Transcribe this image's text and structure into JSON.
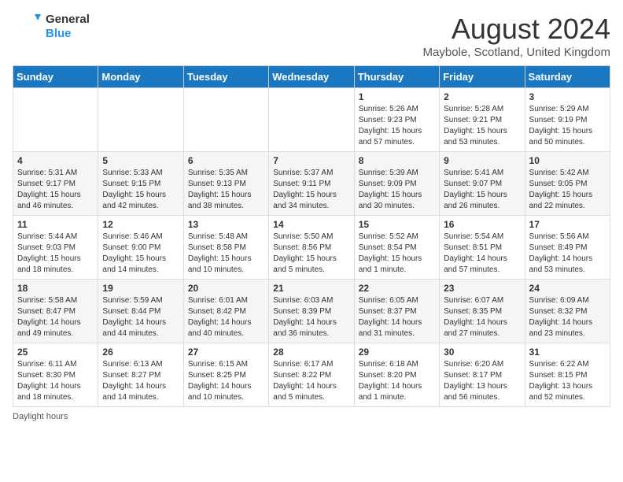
{
  "header": {
    "logo_general": "General",
    "logo_blue": "Blue",
    "month_title": "August 2024",
    "location": "Maybole, Scotland, United Kingdom"
  },
  "days_of_week": [
    "Sunday",
    "Monday",
    "Tuesday",
    "Wednesday",
    "Thursday",
    "Friday",
    "Saturday"
  ],
  "weeks": [
    [
      {
        "day": "",
        "info": ""
      },
      {
        "day": "",
        "info": ""
      },
      {
        "day": "",
        "info": ""
      },
      {
        "day": "",
        "info": ""
      },
      {
        "day": "1",
        "info": "Sunrise: 5:26 AM\nSunset: 9:23 PM\nDaylight: 15 hours\nand 57 minutes."
      },
      {
        "day": "2",
        "info": "Sunrise: 5:28 AM\nSunset: 9:21 PM\nDaylight: 15 hours\nand 53 minutes."
      },
      {
        "day": "3",
        "info": "Sunrise: 5:29 AM\nSunset: 9:19 PM\nDaylight: 15 hours\nand 50 minutes."
      }
    ],
    [
      {
        "day": "4",
        "info": "Sunrise: 5:31 AM\nSunset: 9:17 PM\nDaylight: 15 hours\nand 46 minutes."
      },
      {
        "day": "5",
        "info": "Sunrise: 5:33 AM\nSunset: 9:15 PM\nDaylight: 15 hours\nand 42 minutes."
      },
      {
        "day": "6",
        "info": "Sunrise: 5:35 AM\nSunset: 9:13 PM\nDaylight: 15 hours\nand 38 minutes."
      },
      {
        "day": "7",
        "info": "Sunrise: 5:37 AM\nSunset: 9:11 PM\nDaylight: 15 hours\nand 34 minutes."
      },
      {
        "day": "8",
        "info": "Sunrise: 5:39 AM\nSunset: 9:09 PM\nDaylight: 15 hours\nand 30 minutes."
      },
      {
        "day": "9",
        "info": "Sunrise: 5:41 AM\nSunset: 9:07 PM\nDaylight: 15 hours\nand 26 minutes."
      },
      {
        "day": "10",
        "info": "Sunrise: 5:42 AM\nSunset: 9:05 PM\nDaylight: 15 hours\nand 22 minutes."
      }
    ],
    [
      {
        "day": "11",
        "info": "Sunrise: 5:44 AM\nSunset: 9:03 PM\nDaylight: 15 hours\nand 18 minutes."
      },
      {
        "day": "12",
        "info": "Sunrise: 5:46 AM\nSunset: 9:00 PM\nDaylight: 15 hours\nand 14 minutes."
      },
      {
        "day": "13",
        "info": "Sunrise: 5:48 AM\nSunset: 8:58 PM\nDaylight: 15 hours\nand 10 minutes."
      },
      {
        "day": "14",
        "info": "Sunrise: 5:50 AM\nSunset: 8:56 PM\nDaylight: 15 hours\nand 5 minutes."
      },
      {
        "day": "15",
        "info": "Sunrise: 5:52 AM\nSunset: 8:54 PM\nDaylight: 15 hours\nand 1 minute."
      },
      {
        "day": "16",
        "info": "Sunrise: 5:54 AM\nSunset: 8:51 PM\nDaylight: 14 hours\nand 57 minutes."
      },
      {
        "day": "17",
        "info": "Sunrise: 5:56 AM\nSunset: 8:49 PM\nDaylight: 14 hours\nand 53 minutes."
      }
    ],
    [
      {
        "day": "18",
        "info": "Sunrise: 5:58 AM\nSunset: 8:47 PM\nDaylight: 14 hours\nand 49 minutes."
      },
      {
        "day": "19",
        "info": "Sunrise: 5:59 AM\nSunset: 8:44 PM\nDaylight: 14 hours\nand 44 minutes."
      },
      {
        "day": "20",
        "info": "Sunrise: 6:01 AM\nSunset: 8:42 PM\nDaylight: 14 hours\nand 40 minutes."
      },
      {
        "day": "21",
        "info": "Sunrise: 6:03 AM\nSunset: 8:39 PM\nDaylight: 14 hours\nand 36 minutes."
      },
      {
        "day": "22",
        "info": "Sunrise: 6:05 AM\nSunset: 8:37 PM\nDaylight: 14 hours\nand 31 minutes."
      },
      {
        "day": "23",
        "info": "Sunrise: 6:07 AM\nSunset: 8:35 PM\nDaylight: 14 hours\nand 27 minutes."
      },
      {
        "day": "24",
        "info": "Sunrise: 6:09 AM\nSunset: 8:32 PM\nDaylight: 14 hours\nand 23 minutes."
      }
    ],
    [
      {
        "day": "25",
        "info": "Sunrise: 6:11 AM\nSunset: 8:30 PM\nDaylight: 14 hours\nand 18 minutes."
      },
      {
        "day": "26",
        "info": "Sunrise: 6:13 AM\nSunset: 8:27 PM\nDaylight: 14 hours\nand 14 minutes."
      },
      {
        "day": "27",
        "info": "Sunrise: 6:15 AM\nSunset: 8:25 PM\nDaylight: 14 hours\nand 10 minutes."
      },
      {
        "day": "28",
        "info": "Sunrise: 6:17 AM\nSunset: 8:22 PM\nDaylight: 14 hours\nand 5 minutes."
      },
      {
        "day": "29",
        "info": "Sunrise: 6:18 AM\nSunset: 8:20 PM\nDaylight: 14 hours\nand 1 minute."
      },
      {
        "day": "30",
        "info": "Sunrise: 6:20 AM\nSunset: 8:17 PM\nDaylight: 13 hours\nand 56 minutes."
      },
      {
        "day": "31",
        "info": "Sunrise: 6:22 AM\nSunset: 8:15 PM\nDaylight: 13 hours\nand 52 minutes."
      }
    ]
  ],
  "footer": {
    "daylight_label": "Daylight hours"
  }
}
